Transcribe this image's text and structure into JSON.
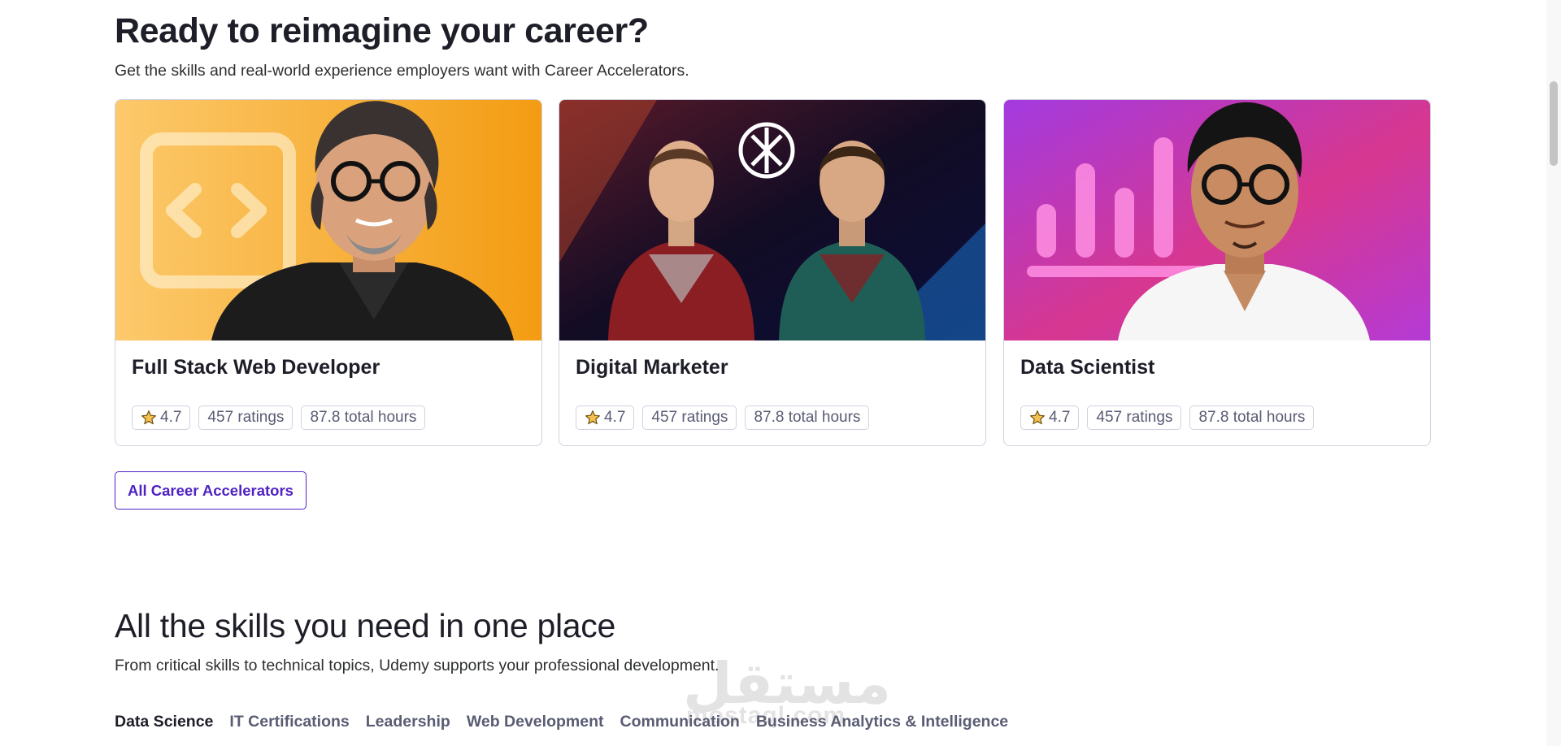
{
  "career": {
    "title": "Ready to reimagine your career?",
    "subtitle": "Get the skills and real-world experience employers want with Career Accelerators.",
    "cards": [
      {
        "title": "Full Stack Web Developer",
        "rating": "4.7",
        "ratings": "457 ratings",
        "hours": "87.8 total hours"
      },
      {
        "title": "Digital Marketer",
        "rating": "4.7",
        "ratings": "457 ratings",
        "hours": "87.8 total hours"
      },
      {
        "title": "Data Scientist",
        "rating": "4.7",
        "ratings": "457 ratings",
        "hours": "87.8 total hours"
      }
    ],
    "button_label": "All Career Accelerators"
  },
  "skills": {
    "title": "All the skills you need in one place",
    "subtitle": "From critical skills to technical topics, Udemy supports your professional development.",
    "tabs": [
      "Data Science",
      "IT Certifications",
      "Leadership",
      "Web Development",
      "Communication",
      "Business Analytics & Intelligence"
    ],
    "active_tab": "Data Science"
  },
  "watermark": {
    "arabic": "مستقل",
    "latin": "mostaql.com"
  },
  "colors": {
    "accent": "#5022c3",
    "star": "#f4c150",
    "card1_bg": "#f5a623",
    "card2_bg": "#1b1030",
    "card3_bg": "#c23ed0"
  },
  "icons": {
    "rating": "star-icon",
    "card1": "code-brackets-icon",
    "card2": "openai-logo-icon",
    "card3": "bar-chart-icon"
  }
}
